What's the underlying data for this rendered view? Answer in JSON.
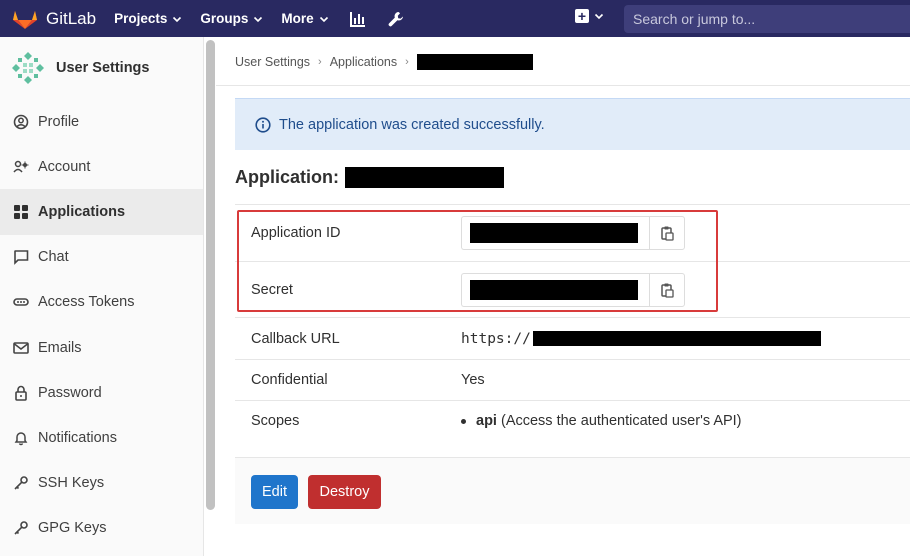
{
  "navbar": {
    "brand": "GitLab",
    "projects": "Projects",
    "groups": "Groups",
    "more": "More",
    "search_placeholder": "Search or jump to..."
  },
  "sidebar": {
    "title": "User Settings",
    "items": [
      {
        "label": "Profile",
        "icon": "profile-icon"
      },
      {
        "label": "Account",
        "icon": "account-icon"
      },
      {
        "label": "Applications",
        "icon": "applications-icon",
        "active": true
      },
      {
        "label": "Chat",
        "icon": "chat-icon"
      },
      {
        "label": "Access Tokens",
        "icon": "token-icon"
      },
      {
        "label": "Emails",
        "icon": "mail-icon"
      },
      {
        "label": "Password",
        "icon": "lock-icon"
      },
      {
        "label": "Notifications",
        "icon": "bell-icon"
      },
      {
        "label": "SSH Keys",
        "icon": "key-icon"
      },
      {
        "label": "GPG Keys",
        "icon": "key-icon"
      }
    ]
  },
  "breadcrumb": {
    "items": [
      "User Settings",
      "Applications"
    ]
  },
  "alert": {
    "message": "The application was created successfully."
  },
  "application": {
    "title": "Application:",
    "rows": {
      "app_id_label": "Application ID",
      "secret_label": "Secret",
      "callback_label": "Callback URL",
      "callback_prefix": "https://",
      "confidential_label": "Confidential",
      "confidential_value": "Yes",
      "scopes_label": "Scopes",
      "scope_name": "api",
      "scope_desc": "(Access the authenticated user's API)"
    }
  },
  "actions": {
    "edit": "Edit",
    "destroy": "Destroy"
  },
  "colors": {
    "navbar": "#292961",
    "alert_bg": "#e1ecf9",
    "edit_button": "#1f75cb",
    "destroy_button": "#c02f2f",
    "highlight_border": "#d83b3b"
  }
}
